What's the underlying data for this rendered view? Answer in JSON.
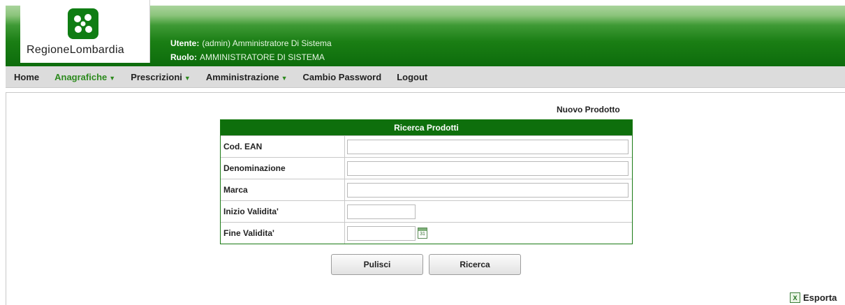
{
  "brand": {
    "logo_text": "RegioneLombardia",
    "accent": "#0e6f0c"
  },
  "user": {
    "user_label": "Utente:",
    "user_value": "(admin) Amministratore Di Sistema",
    "role_label": "Ruolo:",
    "role_value": "AMMINISTRATORE DI SISTEMA"
  },
  "nav": {
    "items": [
      {
        "label": "Home"
      },
      {
        "label": "Anagrafiche"
      },
      {
        "label": "Prescrizioni"
      },
      {
        "label": "Amministrazione"
      },
      {
        "label": "Cambio Password"
      },
      {
        "label": "Logout"
      }
    ]
  },
  "main": {
    "new_product_link": "Nuovo Prodotto",
    "search_title": "Ricerca Prodotti",
    "fields": [
      {
        "label": "Cod. EAN",
        "value": ""
      },
      {
        "label": "Denominazione",
        "value": ""
      },
      {
        "label": "Marca",
        "value": ""
      },
      {
        "label": "Inizio Validita'",
        "value": ""
      },
      {
        "label": "Fine Validita'",
        "value": ""
      }
    ],
    "calendar_day": "31",
    "clear_button": "Pulisci",
    "search_button": "Ricerca",
    "export_label": "Esporta",
    "export_icon_glyph": "X"
  }
}
